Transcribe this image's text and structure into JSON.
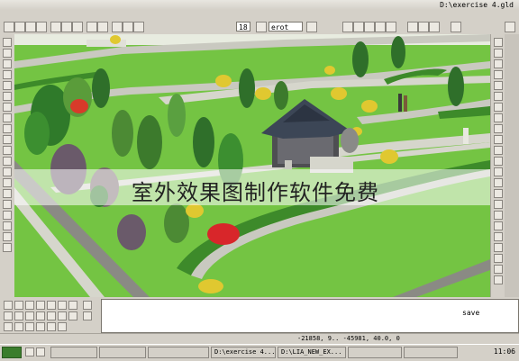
{
  "window": {
    "title": "D:\\exercise 4.gld"
  },
  "toolbar": {
    "text_size": "18",
    "layer": "erot"
  },
  "watermark": {
    "text": "室外效果图制作软件免费"
  },
  "command": {
    "text": "save"
  },
  "status": {
    "coords": "-21858, 9.. -45981, 40.0, 0"
  },
  "taskbar": {
    "items": [
      "D:\\exercise 4...",
      "D:\\LIA_NEW_EX..."
    ],
    "clock": "11:06"
  },
  "colors": {
    "grass": "#6ebf3c",
    "path": "#c9c9c0",
    "roof": "#3c4656",
    "hedge": "#3d8a2a"
  }
}
